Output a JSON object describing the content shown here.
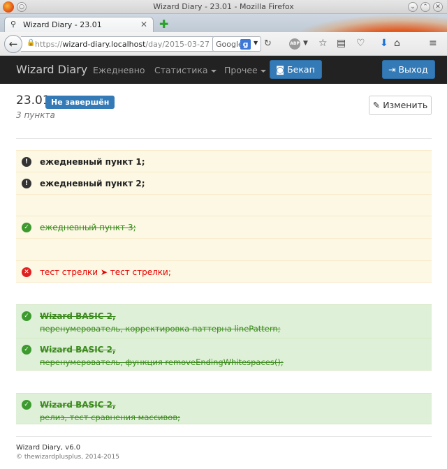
{
  "window": {
    "title": "Wizard Diary - 23.01 - Mozilla Firefox"
  },
  "tab": {
    "title": "Wizard Diary - 23.01"
  },
  "address": {
    "scheme": "https://",
    "host": "wizard-diary.localhost",
    "path": "/day/2015-03-27",
    "search_engine": "Google"
  },
  "nav": {
    "brand": "Wizard Diary",
    "links": [
      "Ежедневно",
      "Статистика",
      "Прочее"
    ],
    "backup_label": "Бекап",
    "logout_label": "Выход"
  },
  "day": {
    "title": "23.01",
    "status_badge": "Не завершён",
    "subtitle": "3 пункта",
    "edit_label": "Изменить"
  },
  "items": [
    {
      "state": "warning",
      "text": "ежедневный пункт 1;"
    },
    {
      "state": "warning",
      "text": "ежедневный пункт 2;"
    },
    {
      "state": "empty",
      "text": ""
    },
    {
      "state": "done",
      "text": "ежедневный пункт 3;"
    },
    {
      "state": "empty",
      "text": ""
    },
    {
      "state": "failed",
      "text": "тест стрелки ➤ тест стрелки;"
    },
    {
      "state": "done",
      "text": "Wizard BASIC 2,",
      "detail": "перенумерователь, корректировка паттерна linePattern;"
    },
    {
      "state": "done",
      "text": "Wizard BASIC 2,",
      "detail": "перенумерователь, функция removeEndingWhitespaces();"
    },
    {
      "state": "done",
      "text": "Wizard BASIC 2,",
      "detail": "релиз, тест сравнения массивов;"
    }
  ],
  "footer": {
    "app": "Wizard Diary, v6.0",
    "copyright": "© thewizardplusplus, 2014-2015"
  },
  "colors": {
    "navbar": "#222222",
    "primary": "#337ab7",
    "warning_bg": "#fcf8e3",
    "success_bg": "#dff0d8",
    "done_text": "#3c8a1e",
    "failed_text": "#e60000"
  }
}
